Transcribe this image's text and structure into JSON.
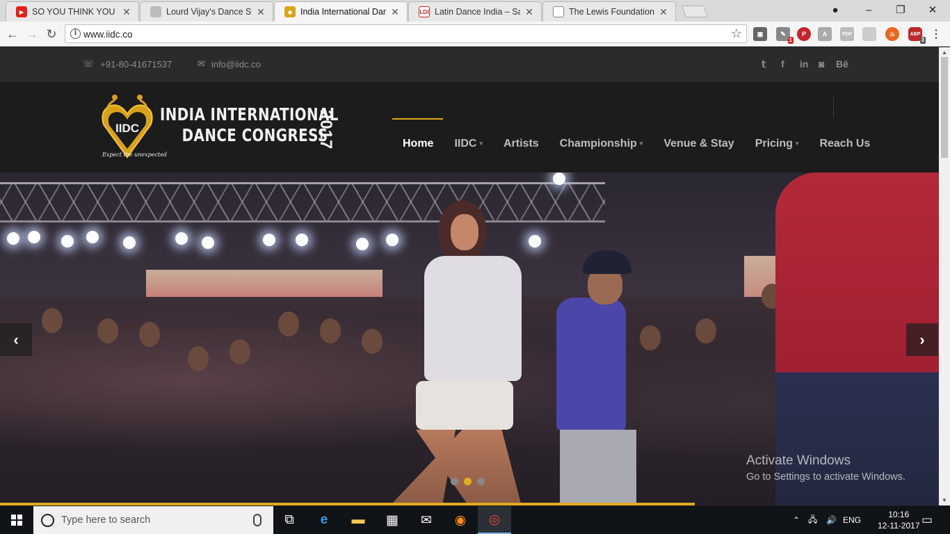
{
  "browser": {
    "tabs": [
      {
        "title": "SO YOU THINK YOU CAN",
        "active": false,
        "favicon": "youtube-icon"
      },
      {
        "title": "Lourd Vijay's Dance Stud",
        "active": false,
        "favicon": "dance-studio-icon"
      },
      {
        "title": "India International Dance",
        "active": true,
        "favicon": "iidc-icon"
      },
      {
        "title": "Latin Dance India – Salsa",
        "active": false,
        "favicon": "ldi-icon"
      },
      {
        "title": "The Lewis Foundation of",
        "active": false,
        "favicon": "page-icon"
      }
    ],
    "url": "www.iidc.co",
    "extension_badges": {
      "notify": "1",
      "abp": "3"
    }
  },
  "site": {
    "topbar": {
      "phone": "+91-80-41671537",
      "email": "info@iidc.co",
      "social": [
        "twitter-icon",
        "facebook-icon",
        "linkedin-icon",
        "instagram-icon",
        "behance-icon"
      ],
      "behance_label": "Bē"
    },
    "logo": {
      "mark": "IIDC",
      "line1": "INDIA INTERNATIONAL",
      "line2": "DANCE CONGRESS",
      "year": "2017",
      "tagline": "Expect the unexpected"
    },
    "nav": [
      {
        "label": "Home",
        "active": true,
        "dropdown": false
      },
      {
        "label": "IIDC",
        "active": false,
        "dropdown": true
      },
      {
        "label": "Artists",
        "active": false,
        "dropdown": false
      },
      {
        "label": "Championship",
        "active": false,
        "dropdown": true
      },
      {
        "label": "Venue & Stay",
        "active": false,
        "dropdown": false
      },
      {
        "label": "Pricing",
        "active": false,
        "dropdown": true
      },
      {
        "label": "Reach Us",
        "active": false,
        "dropdown": false
      }
    ],
    "slider": {
      "slide_count": 3,
      "active_slide": 2,
      "progress": 0.74
    },
    "watermark": {
      "title": "Activate Windows",
      "subtitle": "Go to Settings to activate Windows."
    }
  },
  "taskbar": {
    "search_placeholder": "Type here to search",
    "apps": [
      "task-view-icon",
      "edge-icon",
      "file-explorer-icon",
      "store-icon",
      "mail-icon",
      "firefox-icon",
      "chrome-icon"
    ],
    "language": "ENG",
    "time": "10:16",
    "date": "12-11-2017"
  },
  "colors": {
    "accent": "#e0a91e",
    "header_bg": "#1c1c1c",
    "topbar_bg": "#2b2b2b"
  }
}
